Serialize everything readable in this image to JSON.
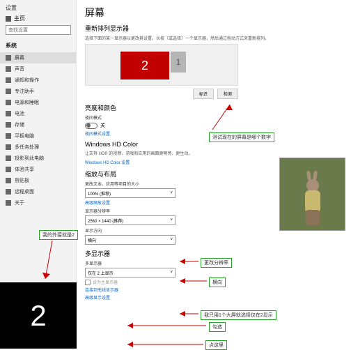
{
  "sidebar": {
    "app_title": "设置",
    "home": "主页",
    "search_placeholder": "查找设置",
    "section": "系统",
    "items": [
      {
        "icon": "display",
        "label": "屏幕"
      },
      {
        "icon": "sound",
        "label": "声音"
      },
      {
        "icon": "notify",
        "label": "通知和操作"
      },
      {
        "icon": "focus",
        "label": "专注助手"
      },
      {
        "icon": "power",
        "label": "电源和睡眠"
      },
      {
        "icon": "battery",
        "label": "电池"
      },
      {
        "icon": "storage",
        "label": "存储"
      },
      {
        "icon": "tablet",
        "label": "平板电脑"
      },
      {
        "icon": "multi",
        "label": "多任务处理"
      },
      {
        "icon": "project",
        "label": "投影到此电脑"
      },
      {
        "icon": "share",
        "label": "体验共享"
      },
      {
        "icon": "clip",
        "label": "剪贴板"
      },
      {
        "icon": "remote",
        "label": "远程桌面"
      },
      {
        "icon": "about",
        "label": "关于"
      }
    ]
  },
  "main": {
    "title": "屏幕",
    "rearrange": {
      "heading": "重新排列显示器",
      "hint": "选择下面的某一显示器以更改其设置。长按（或选择）一个显示器，然后通过拖动方式来重新排列。",
      "mon2": "2",
      "mon1": "1",
      "identify": "标识",
      "detect": "检测"
    },
    "brightness": {
      "heading": "亮度和颜色",
      "night_label": "夜间模式",
      "toggle_state": "关",
      "night_link": "夜间模式设置"
    },
    "hdr": {
      "heading": "Windows HD Color",
      "hint": "让支持 HDR 的视频、游戏和应用的画面更明亮、更生动。",
      "link": "Windows HD Color 设置"
    },
    "scale": {
      "heading": "缩放与布局",
      "text_size_label": "更改文本、应用等项目的大小",
      "text_size_value": "100% (推荐)",
      "adv_link": "高级缩放设置",
      "res_label": "显示器分辨率",
      "res_value": "2560 × 1440 (推荐)",
      "orient_label": "显示方向",
      "orient_value": "横向"
    },
    "multi": {
      "heading": "多显示器",
      "mode_label": "多显示器",
      "mode_value": "仅在 2 上显示",
      "main_chk": "设为主显示器",
      "wireless_link": "连接到无线显示器",
      "adv_link": "高级显示设置"
    }
  },
  "annotations": {
    "a1": "测试现在的屏幕是哪个数字",
    "a2": "我的外接就是2",
    "a3": "更改分辨率",
    "a4": "横向",
    "a5": "我只用1个大屏就选择仅在2显示",
    "a6": "勾选",
    "a7": "点这里"
  },
  "overlay_num": "2"
}
